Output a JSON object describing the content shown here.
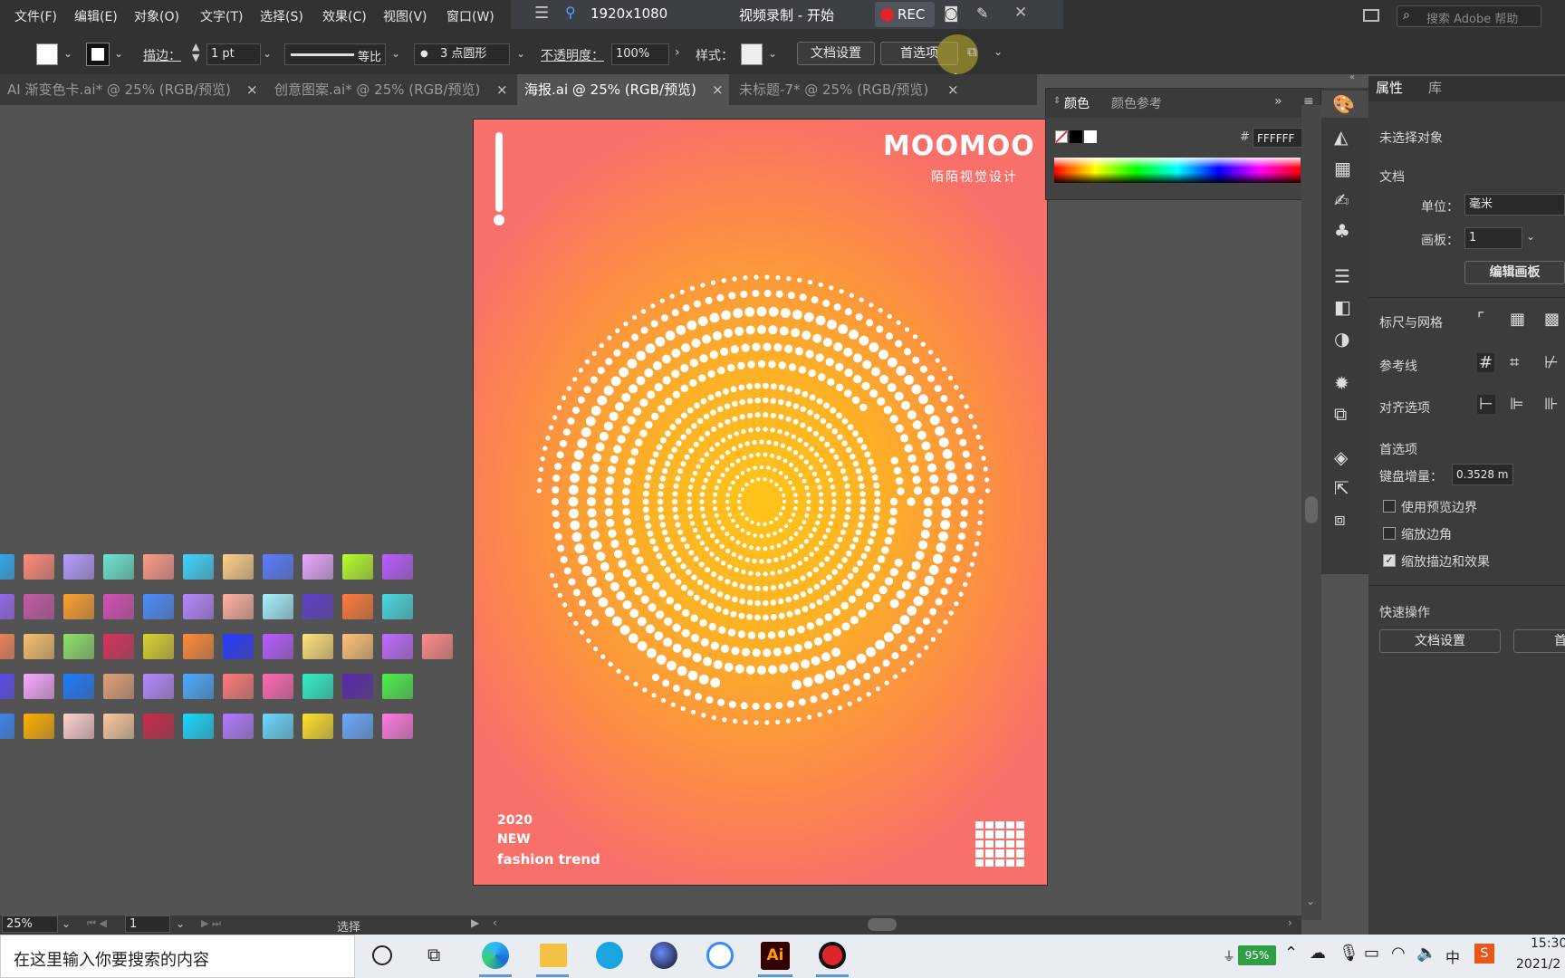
{
  "menu": [
    "文件(F)",
    "编辑(E)",
    "对象(O)",
    "文字(T)",
    "选择(S)",
    "效果(C)",
    "视图(V)",
    "窗口(W)"
  ],
  "rec": {
    "resolution": "1920x1080",
    "title": "视频录制 - 开始",
    "rec_label": "REC"
  },
  "search": {
    "placeholder": "搜索 Adobe 帮助"
  },
  "toolbar": {
    "stroke_label": "描边：",
    "stroke_value": "1 pt",
    "profile": "等比",
    "brush": "3 点圆形",
    "opacity_label": "不透明度：",
    "opacity_value": "100%",
    "style_label": "样式：",
    "doc_settings": "文档设置",
    "preferences": "首选项"
  },
  "tabs": [
    {
      "label": "AI 渐变色卡.ai* @ 25% (RGB/预览)"
    },
    {
      "label": "创意图案.ai* @ 25% (RGB/预览)"
    },
    {
      "label": "海报.ai @ 25% (RGB/预览)"
    },
    {
      "label": "未标题-7* @ 25% (RGB/预览)"
    }
  ],
  "poster": {
    "brand": "MOOMOO",
    "subtitle": "陌陌视觉设计",
    "year": "2020",
    "new": "NEW",
    "trend": "fashion trend"
  },
  "color_panel": {
    "tab1": "颜色",
    "tab2": "颜色参考",
    "hex_label": "#",
    "hex": "FFFFFF"
  },
  "properties": {
    "tab1": "属性",
    "tab2": "库",
    "no_selection": "未选择对象",
    "document": "文档",
    "unit_label": "单位：",
    "unit_value": "毫米",
    "artboard_label": "画板：",
    "artboard_value": "1",
    "edit_artboard": "编辑画板",
    "rulers_grids": "标尺与网格",
    "guides": "参考线",
    "snap": "对齐选项",
    "prefs": "首选项",
    "key_inc_label": "键盘增量：",
    "key_inc_value": "0.3528 m",
    "use_preview": "使用预览边界",
    "scale_corners": "缩放边角",
    "scale_strokes": "缩放描边和效果",
    "quick_actions": "快速操作",
    "qa_doc_settings": "文档设置",
    "qa_prefs": "首"
  },
  "status": {
    "zoom": "25%",
    "page": "1",
    "tool": "选择"
  },
  "taskbar": {
    "search_placeholder": "在这里输入你要搜索的内容",
    "battery": "95%",
    "time": "15:30",
    "date": "2021/2"
  },
  "swatch_colors": [
    [
      "#2fb3ff",
      "#ff8a7a",
      "#b59cff",
      "#6be6d0",
      "#ff9a8a",
      "#3fd5ff",
      "#ffd08a",
      "#5a7cff",
      "#e7a9ff",
      "#b7ff2a",
      "#b95cff"
    ],
    [
      "#9b6bff",
      "#c45aa8",
      "#ff9f2f",
      "#d64fb7",
      "#4a8cff",
      "#b486ff",
      "#ffb0a0",
      "#a6f0ff",
      "#5f3fc8",
      "#ff7a3a",
      "#48d9e0"
    ],
    [
      "#ff8a5a",
      "#f6c16b",
      "#8ee06a",
      "#d7335e",
      "#d9d22f",
      "#ff8a3a",
      "#2a3aff",
      "#b75cff",
      "#ffe27a",
      "#ffc27a",
      "#c06aff",
      "#ff8a8a"
    ],
    [
      "#5a4cff",
      "#f7a9ff",
      "#1f7aff",
      "#e0a07a",
      "#b28aff",
      "#4aa9ff",
      "#ff7a7a",
      "#ff6ab0",
      "#2ff0c8",
      "#5a2aaa",
      "#4cf04c"
    ],
    [
      "#3a8aff",
      "#ffb000",
      "#ffd0d0",
      "#f7c9a0",
      "#c82a4a",
      "#18d8ff",
      "#b07aff",
      "#6ad8ff",
      "#ffe02a",
      "#6aa8ff",
      "#ff7ae0"
    ]
  ]
}
